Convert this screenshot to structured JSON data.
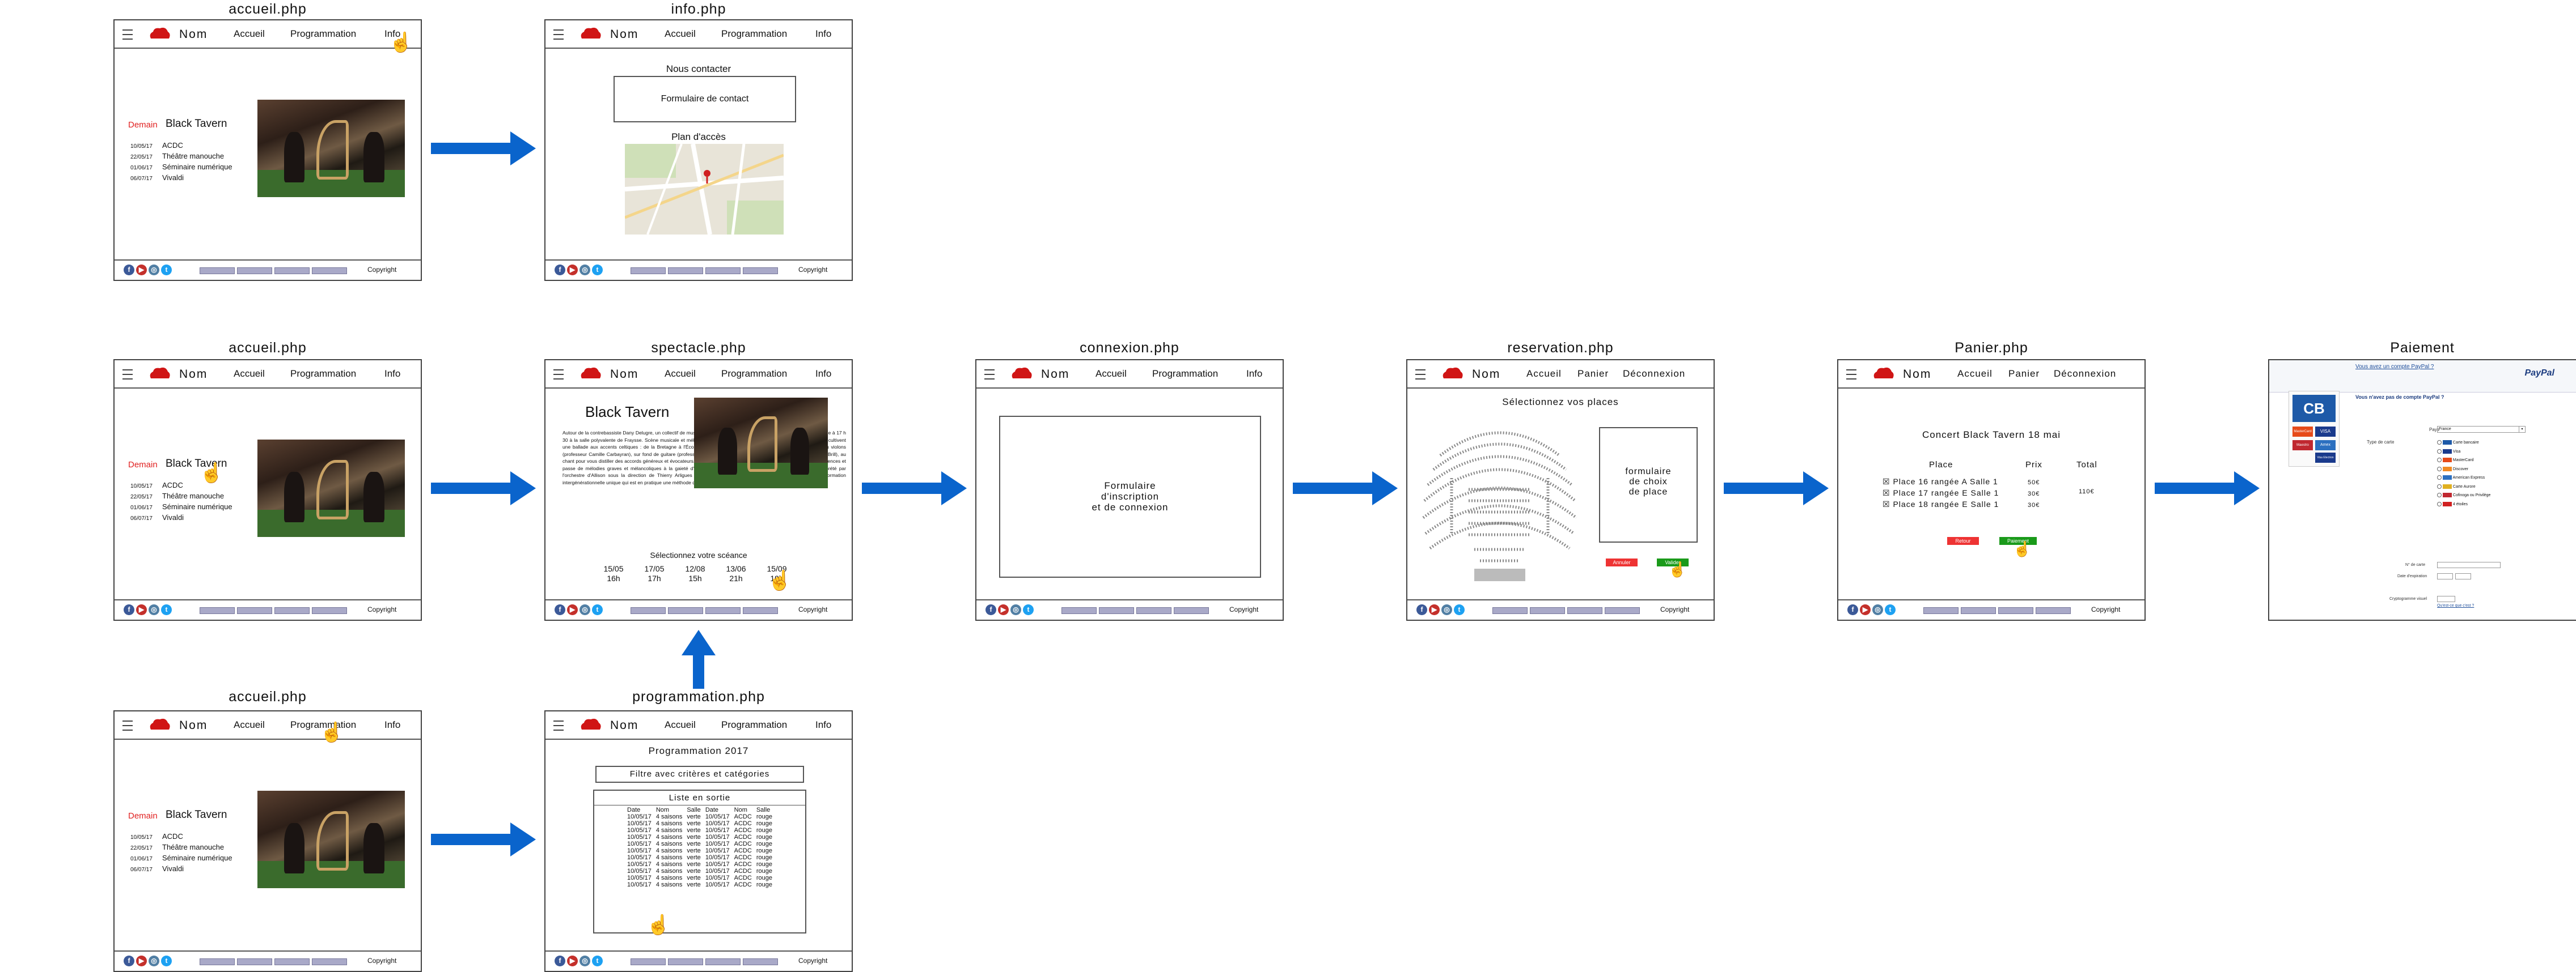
{
  "site_name": "Nom",
  "colors": {
    "arrow": "#0a64cc",
    "demain": "#e02020",
    "logo": "#d01515"
  },
  "nav": {
    "accueil": "Accueil",
    "programmation": "Programmation",
    "info": "Info",
    "panier": "Panier",
    "deconnexion": "Déconnexion"
  },
  "footer": {
    "copyright": "Copyright",
    "social": [
      "f",
      "▶",
      "◎",
      "t"
    ]
  },
  "titles": {
    "accueil_top": "accueil.php",
    "info": "info.php",
    "accueil_mid": "accueil.php",
    "spectacle": "spectacle.php",
    "connexion": "connexion.php",
    "reservation": "reservation.php",
    "panier": "Panier.php",
    "paiement": "Paiement",
    "accueil_bot": "accueil.php",
    "programmation": "programmation.php"
  },
  "accueil": {
    "demain_label": "Demain",
    "headline": "Black Tavern",
    "events": [
      {
        "date": "10/05/17",
        "name": "ACDC"
      },
      {
        "date": "22/05/17",
        "name": "Théâtre manouche"
      },
      {
        "date": "01/06/17",
        "name": "Séminaire numérique"
      },
      {
        "date": "06/07/17",
        "name": "Vivaldi"
      }
    ]
  },
  "info": {
    "contact_heading": "Nous contacter",
    "contact_form": "Formulaire de contact",
    "map_heading": "Plan d'accès"
  },
  "spectacle": {
    "title": "Black Tavern",
    "body": "Autour de la contrebassiste Dany Delugre, un collectif de musiciens du Conservatoire de musique et de danse se produira le à 17 h 30 à la salle polyvalente de Fraysse. Scène musicale et mélodies vibrantes de poésie insulaire. Les membres du groupe cultivent une ballade aux accents celtiques : de la Bretagne à l'Écosse. Les sons captivants de la cornemuse, de la flûte, et du violons (professeur Camille Carbayran), sur fond de guitare (professeur Arnaud Deschal et Aurélien Clément), au piano (Pauline Brill), au chant pour vous distiller des accords généreux et évocateurs. Très riche, la musique celtique s'est nourrie de multiples influences et passe de mélodies graves et mélancoliques à la gaieté d'une gigue irlandaise. Le programme sera notamment interprété par l'orchestre d'Allison sous la direction de Thierry Arligues réunit parents et anciens musiciens. Ils constituent une formation intergénérationnelle unique qui est en pratique une méthode d'Écossaise conçue au Vénézuéla",
    "select_label": "Sélectionnez votre scéance",
    "sessions": [
      {
        "date": "15/05",
        "time": "16h"
      },
      {
        "date": "17/05",
        "time": "17h"
      },
      {
        "date": "12/08",
        "time": "15h"
      },
      {
        "date": "13/06",
        "time": "21h"
      },
      {
        "date": "15/09",
        "time": "19h"
      }
    ]
  },
  "connexion": {
    "line1": "Formulaire",
    "line2": "d'inscription",
    "line3": "et de connexion"
  },
  "reservation": {
    "heading": "Sélectionnez vos places",
    "form_line1": "formulaire",
    "form_line2": "de choix",
    "form_line3": "de place",
    "cancel": "Annuler",
    "validate": "Valider"
  },
  "panier": {
    "heading": "Concert Black Tavern 18 mai",
    "col_place": "Place",
    "col_prix": "Prix",
    "col_total": "Total",
    "rows": [
      {
        "place": "Place 16 rangée A Salle 1",
        "prix": "50€"
      },
      {
        "place": "Place 17 rangée E Salle 1",
        "prix": "30€"
      },
      {
        "place": "Place 18 rangée E Salle 1",
        "prix": "30€"
      }
    ],
    "total": "110€",
    "back": "Retour",
    "pay": "Paiement"
  },
  "paiement": {
    "paypal_link": "Vous avez un compte PayPal ?",
    "paypal_brand": "PayPal",
    "no_paypal": "Vous n'avez pas de compte PayPal ?",
    "cards": [
      "Carte bancaire",
      "Visa",
      "MasterCard",
      "Discover",
      "American Express",
      "Carte Aurore",
      "Cofinoga ou Privilège",
      "4 étoiles"
    ],
    "pays_label": "Pays",
    "pays_value": "France",
    "type_label": "Type de carte",
    "num_label": "N° de carte",
    "exp_label": "Date d'expiration",
    "crypto_label": "Cryptogramme visuel",
    "crypto_help": "Qu'est-ce que c'est ?",
    "left_logos": [
      "CB",
      "MasterCard",
      "VISA",
      "Maestro",
      "Amex",
      "Visa Electron"
    ]
  },
  "programmation": {
    "heading": "Programmation 2017",
    "filter": "Filtre avec critères et catégories",
    "list_title": "Liste en sortie",
    "headers": [
      "Date",
      "Nom",
      "Salle",
      "Date",
      "Nom",
      "Salle"
    ],
    "rows": [
      [
        "10/05/17",
        "4 saisons",
        "verte",
        "10/05/17",
        "ACDC",
        "rouge"
      ],
      [
        "10/05/17",
        "4 saisons",
        "verte",
        "10/05/17",
        "ACDC",
        "rouge"
      ],
      [
        "10/05/17",
        "4 saisons",
        "verte",
        "10/05/17",
        "ACDC",
        "rouge"
      ],
      [
        "10/05/17",
        "4 saisons",
        "verte",
        "10/05/17",
        "ACDC",
        "rouge"
      ],
      [
        "10/05/17",
        "4 saisons",
        "verte",
        "10/05/17",
        "ACDC",
        "rouge"
      ],
      [
        "10/05/17",
        "4 saisons",
        "verte",
        "10/05/17",
        "ACDC",
        "rouge"
      ],
      [
        "10/05/17",
        "4 saisons",
        "verte",
        "10/05/17",
        "ACDC",
        "rouge"
      ],
      [
        "10/05/17",
        "4 saisons",
        "verte",
        "10/05/17",
        "ACDC",
        "rouge"
      ],
      [
        "10/05/17",
        "4 saisons",
        "verte",
        "10/05/17",
        "ACDC",
        "rouge"
      ],
      [
        "10/05/17",
        "4 saisons",
        "verte",
        "10/05/17",
        "ACDC",
        "rouge"
      ],
      [
        "10/05/17",
        "4 saisons",
        "verte",
        "10/05/17",
        "ACDC",
        "rouge"
      ]
    ]
  }
}
